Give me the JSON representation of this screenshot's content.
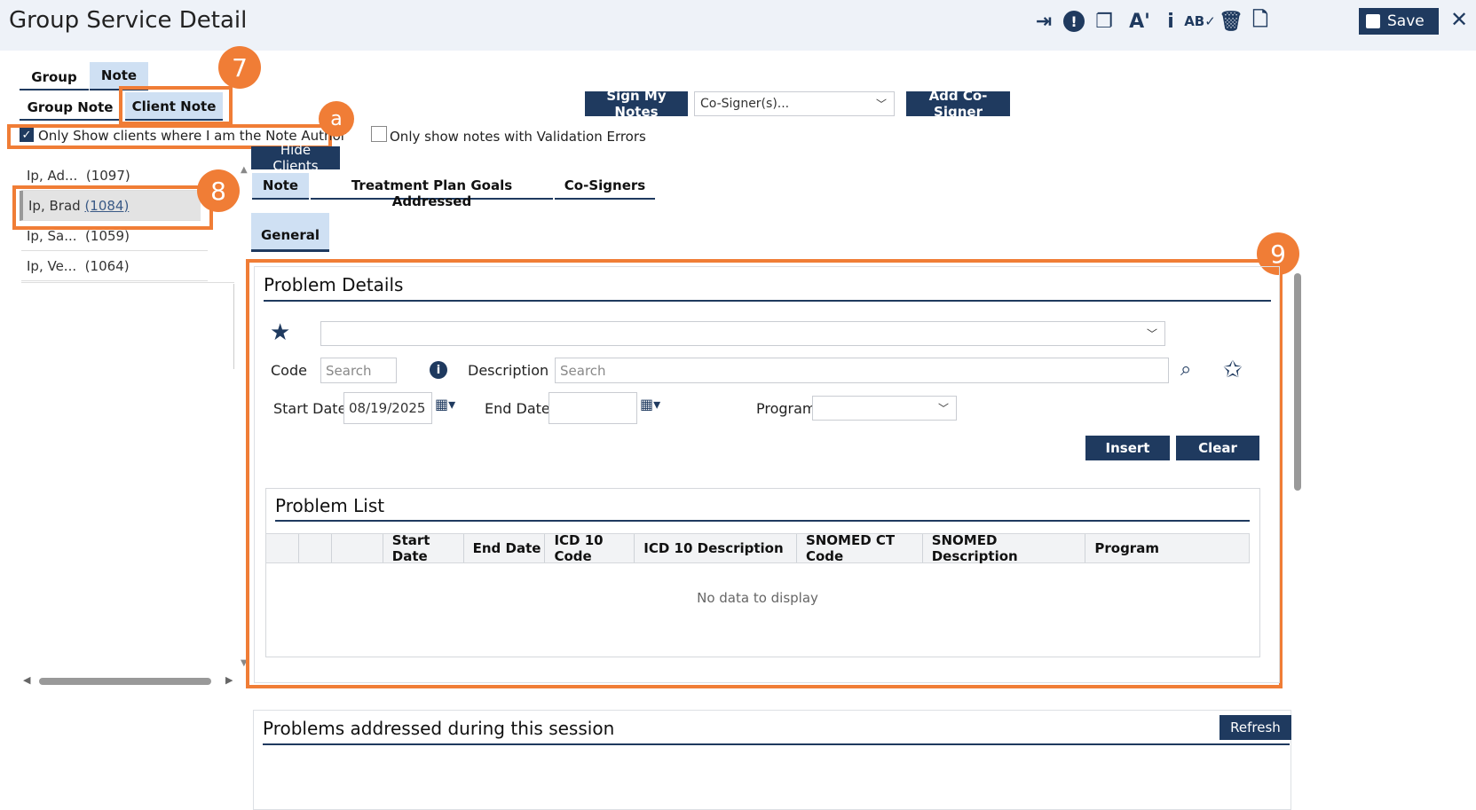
{
  "window": {
    "title": "Group Service Detail"
  },
  "toolbar": {
    "icons": [
      "sign-in-icon",
      "alert-icon",
      "copy-icon",
      "font-size-icon",
      "info-icon",
      "spellcheck-icon",
      "trash-icon",
      "document-icon"
    ],
    "save_label": "Save",
    "close_glyph": "✕"
  },
  "tabs_top": {
    "group": "Group",
    "note": "Note"
  },
  "tabs_sub": {
    "group_note": "Group Note",
    "client_note": "Client Note"
  },
  "filters": {
    "note_author_label": "Only Show clients where I am the Note Author",
    "note_author_checked": true,
    "validation_label": "Only show notes with Validation Errors",
    "validation_checked": false
  },
  "cosign": {
    "sign_label": "Sign My Notes",
    "cosigner_select": "Co-Signer(s)...",
    "add_label": "Add Co-Signer"
  },
  "clients": {
    "hide_label": "Hide Clients",
    "items": [
      {
        "name": "Ip, Ad...",
        "id": "(1097)"
      },
      {
        "name": "Ip, Brad",
        "id": "(1084)"
      },
      {
        "name": "Ip, Sa...",
        "id": "(1059)"
      },
      {
        "name": "Ip, Ve...",
        "id": "(1064)"
      }
    ]
  },
  "note_tabs": {
    "note": "Note",
    "goals": "Treatment Plan Goals Addressed",
    "cosigners": "Co-Signers"
  },
  "general_tab": "General",
  "problem_details": {
    "title": "Problem Details",
    "code_label": "Code",
    "code_placeholder": "Search",
    "description_label": "Description",
    "description_placeholder": "Search",
    "start_label": "Start Date:",
    "start_value": "08/19/2025",
    "end_label": "End Date:",
    "end_value": "",
    "program_label": "Program",
    "insert_label": "Insert",
    "clear_label": "Clear"
  },
  "problem_list": {
    "title": "Problem List",
    "columns": [
      "Start Date",
      "End Date",
      "ICD 10 Code",
      "ICD 10 Description",
      "SNOMED CT Code",
      "SNOMED Description",
      "Program"
    ],
    "empty": "No data to display"
  },
  "addressed": {
    "title": "Problems addressed during this session",
    "refresh_label": "Refresh"
  },
  "annotations": {
    "a": "a",
    "n7": "7",
    "n8": "8",
    "n9": "9"
  },
  "colors": {
    "accent": "#1f3a5f",
    "highlight": "#f07d36",
    "tab_active": "#cfe0f3"
  }
}
